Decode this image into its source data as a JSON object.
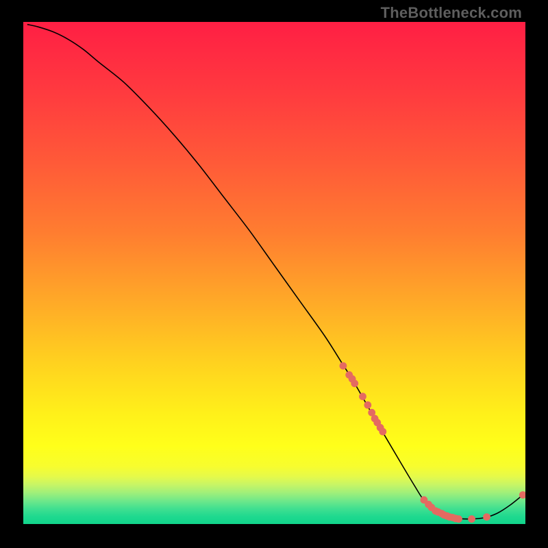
{
  "watermark": "TheBottleneck.com",
  "gradient": {
    "stops": [
      {
        "offset": 0.0,
        "color": "#ff1f44"
      },
      {
        "offset": 0.14,
        "color": "#ff3a3f"
      },
      {
        "offset": 0.28,
        "color": "#ff5a38"
      },
      {
        "offset": 0.42,
        "color": "#ff7d30"
      },
      {
        "offset": 0.55,
        "color": "#ffa728"
      },
      {
        "offset": 0.68,
        "color": "#ffd21f"
      },
      {
        "offset": 0.78,
        "color": "#fff01a"
      },
      {
        "offset": 0.845,
        "color": "#ffff1a"
      },
      {
        "offset": 0.885,
        "color": "#f7fd2e"
      },
      {
        "offset": 0.905,
        "color": "#e6fa4a"
      },
      {
        "offset": 0.922,
        "color": "#c6f566"
      },
      {
        "offset": 0.938,
        "color": "#9fef7a"
      },
      {
        "offset": 0.954,
        "color": "#6ee88a"
      },
      {
        "offset": 0.97,
        "color": "#3fdf90"
      },
      {
        "offset": 0.985,
        "color": "#1fd98f"
      },
      {
        "offset": 1.0,
        "color": "#11d48b"
      }
    ]
  },
  "chart_data": {
    "type": "line",
    "title": "",
    "xlabel": "",
    "ylabel": "",
    "xlim": [
      0,
      100
    ],
    "ylim": [
      0,
      100
    ],
    "grid": false,
    "series": [
      {
        "name": "curve",
        "x": [
          0.8,
          3,
          6,
          9,
          12,
          15,
          20,
          25,
          30,
          35,
          40,
          45,
          50,
          55,
          60,
          63.5,
          66,
          70,
          75,
          78,
          80,
          83,
          86,
          89,
          92,
          94.5,
          97,
          99.5
        ],
        "y": [
          99.5,
          99,
          98,
          96.5,
          94.5,
          92,
          88,
          83,
          77.5,
          71.5,
          65,
          58.5,
          51.5,
          44.5,
          37.5,
          32,
          28,
          21,
          12.5,
          7.5,
          4.5,
          2.3,
          1.2,
          1.0,
          1.3,
          2.2,
          3.8,
          5.8
        ]
      }
    ],
    "markers": [
      {
        "x": 63.7,
        "y": 31.5
      },
      {
        "x": 64.9,
        "y": 29.7
      },
      {
        "x": 65.5,
        "y": 28.9
      },
      {
        "x": 66.0,
        "y": 28.0
      },
      {
        "x": 67.6,
        "y": 25.4
      },
      {
        "x": 68.6,
        "y": 23.7
      },
      {
        "x": 69.4,
        "y": 22.2
      },
      {
        "x": 70.0,
        "y": 21.0
      },
      {
        "x": 70.5,
        "y": 20.2
      },
      {
        "x": 71.1,
        "y": 19.2
      },
      {
        "x": 71.6,
        "y": 18.4
      },
      {
        "x": 79.8,
        "y": 4.8
      },
      {
        "x": 80.7,
        "y": 3.9
      },
      {
        "x": 81.3,
        "y": 3.3
      },
      {
        "x": 82.1,
        "y": 2.6
      },
      {
        "x": 82.6,
        "y": 2.4
      },
      {
        "x": 83.3,
        "y": 2.1
      },
      {
        "x": 83.8,
        "y": 1.8
      },
      {
        "x": 84.4,
        "y": 1.6
      },
      {
        "x": 84.9,
        "y": 1.4
      },
      {
        "x": 85.5,
        "y": 1.3
      },
      {
        "x": 86.1,
        "y": 1.1
      },
      {
        "x": 86.7,
        "y": 1.0
      },
      {
        "x": 89.3,
        "y": 1.0
      },
      {
        "x": 92.3,
        "y": 1.4
      },
      {
        "x": 99.5,
        "y": 5.8
      }
    ]
  }
}
